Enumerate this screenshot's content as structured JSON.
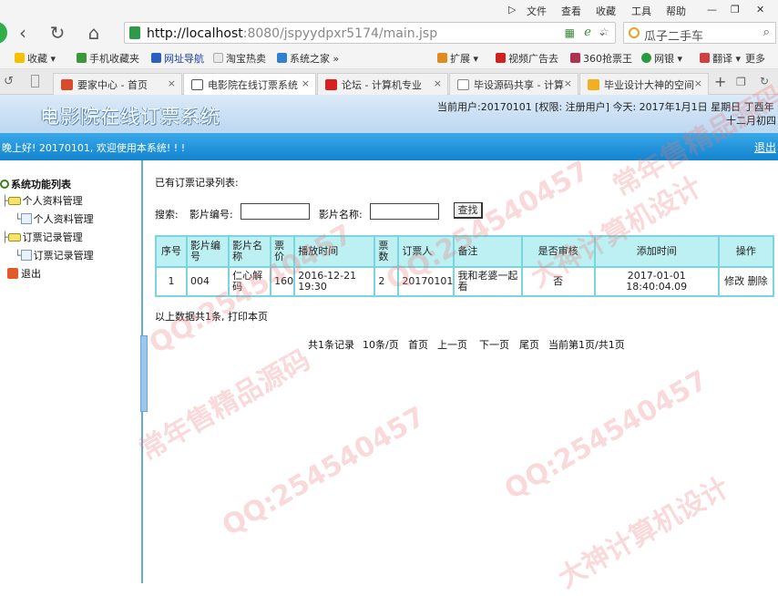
{
  "browser": {
    "menu": [
      "文件",
      "查看",
      "收藏",
      "工具",
      "帮助"
    ],
    "url_host": "http://localhost",
    "url_rest": ":8080/jspyydpxr5174/main.jsp",
    "search_text": "瓜子二手车",
    "favorites": [
      "收藏",
      "手机收藏夹",
      "网址导航",
      "淘宝热卖",
      "系统之家",
      "扩展",
      "视频广告去",
      "360抢票王",
      "网银",
      "翻译",
      "更多"
    ],
    "tabs": [
      {
        "label": "要家中心 - 首页",
        "color": "#d84a2a"
      },
      {
        "label": "电影院在线订票系统",
        "color": "#555555"
      },
      {
        "label": "论坛 - 计算机专业",
        "color": "#d82020"
      },
      {
        "label": "毕设源码共享 - 计算",
        "color": "#888888"
      },
      {
        "label": "毕业设计大神的空间",
        "color": "#f0b020"
      }
    ],
    "tab_close": "×",
    "tab_new": "+"
  },
  "app": {
    "title": "电影院在线订票系统",
    "user_info": "当前用户:20170101 [权限: 注册用户] 今天: 2017年1月1日 星期日 丁酉年",
    "lunar": "十二月初四",
    "welcome": "晚上好! 20170101, 欢迎使用本系统! ! !",
    "logout": "退出"
  },
  "sidebar": {
    "root": "系统功能列表",
    "groups": [
      {
        "label": "个人资料管理",
        "child": "个人资料管理"
      },
      {
        "label": "订票记录管理",
        "child": "订票记录管理"
      }
    ],
    "exit": "退出"
  },
  "main": {
    "heading": "已有订票记录列表:",
    "search_label": "搜索:",
    "film_no_label": "影片编号:",
    "film_no_value": "",
    "film_name_label": "影片名称:",
    "film_name_value": "",
    "search_button": "查找",
    "columns": [
      "序号",
      "影片编号",
      "影片名称",
      "票价",
      "播放时间",
      "票数",
      "订票人",
      "备注",
      "是否审核",
      "添加时间",
      "操作"
    ],
    "rows": [
      {
        "index": "1",
        "film_no": "004",
        "film_name": "仁心解码",
        "price": "160",
        "show_time": "2016-12-21 19:30",
        "count": "2",
        "booker": "20170101",
        "remark": "我和老婆一起看",
        "reviewed": "否",
        "added": "2017-01-01 18:40:04.09",
        "edit": "修改",
        "delete": "删除"
      }
    ],
    "summary": "以上数据共1条,",
    "print": "打印本页",
    "pager": {
      "total": "共1条记录",
      "per_page": "10条/页",
      "first": "首页",
      "prev": "上一页",
      "next": "下一页",
      "last": "尾页",
      "current": "当前第1页/共1页"
    }
  },
  "watermarks": [
    "QQ:254540457",
    "常年售精品源码",
    "大神计算机设计"
  ]
}
